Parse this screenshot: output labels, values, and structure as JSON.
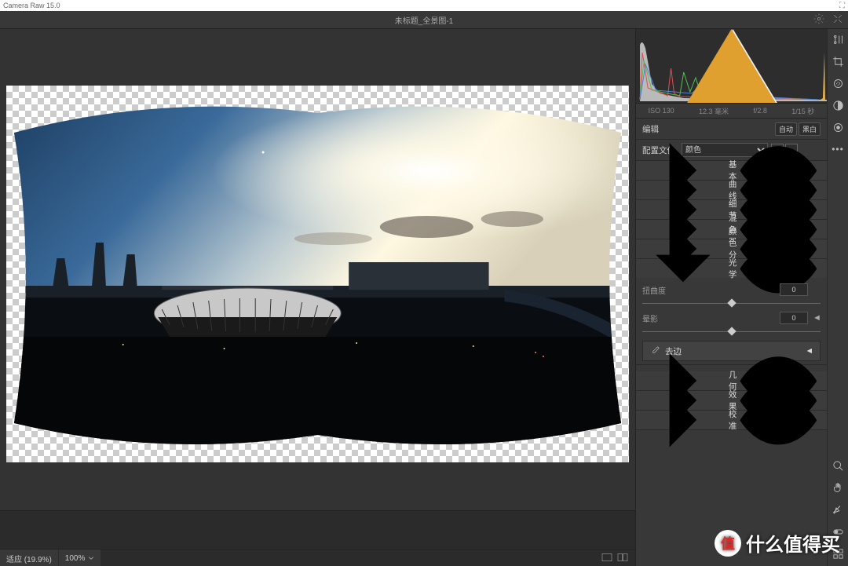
{
  "app_title": "Camera Raw 15.0",
  "doc_title": "未标题_全景图-1",
  "metadata": {
    "iso": "ISO 130",
    "focal": "12.3 毫米",
    "aperture": "f/2.8",
    "shutter": "1/15 秒"
  },
  "edit_header": {
    "label": "编辑",
    "auto": "自动",
    "bw": "黑白"
  },
  "profile": {
    "label": "配置文件",
    "value": "颜色"
  },
  "panels": {
    "basic": "基本",
    "curve": "曲线",
    "detail": "细节",
    "mixer": "混色器",
    "grading": "颜色分级",
    "optics": "光学",
    "geometry": "几何",
    "effects": "效果",
    "calibration": "校准"
  },
  "optics": {
    "distortion": {
      "label": "扭曲度",
      "value": "0"
    },
    "vignette": {
      "label": "晕影",
      "value": "0"
    },
    "defringe": "去边"
  },
  "status": {
    "fit": "适应 (19.9%)",
    "zoom": "100%"
  },
  "watermark": "什么值得买",
  "badge": "值"
}
